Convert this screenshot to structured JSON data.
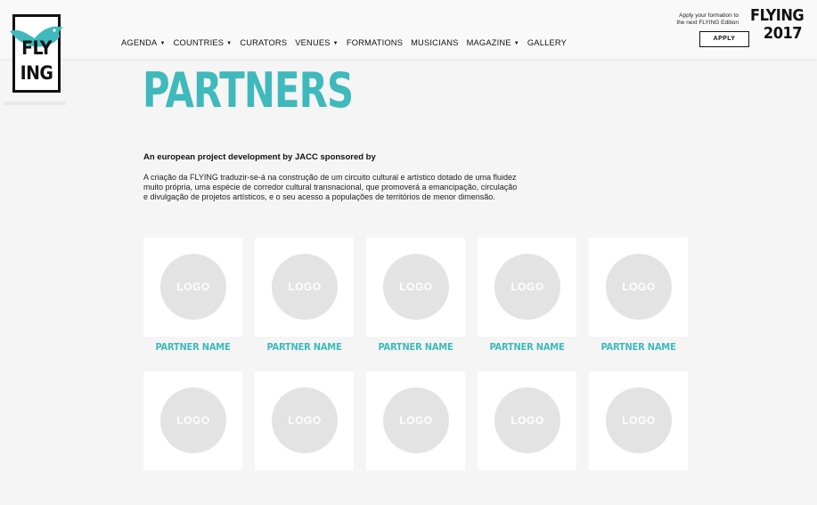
{
  "brand": {
    "logo_line1": "FLY",
    "logo_line2": "ING"
  },
  "nav": [
    {
      "label": "AGENDA",
      "caret": "▼"
    },
    {
      "label": "COUNTRIES",
      "caret": "▼"
    },
    {
      "label": "CURATORS",
      "caret": ""
    },
    {
      "label": "VENUES",
      "caret": "▼"
    },
    {
      "label": "FORMATIONS",
      "caret": ""
    },
    {
      "label": "MUSICIANS",
      "caret": ""
    },
    {
      "label": "MAGAZINE",
      "caret": "▼"
    },
    {
      "label": "GALLERY",
      "caret": ""
    }
  ],
  "apply": {
    "text_line1": "Apply your formation to",
    "text_line2": "the next FLYING Edition",
    "button": "APPLY"
  },
  "edition": {
    "line1": "FLYING",
    "line2": "2017"
  },
  "page": {
    "title": "PARTNERS",
    "subtitle": "An european project development by JACC sponsored by",
    "intro": "A criação da FLYING traduzir-se-á na construção de um circuito cultural e artístico dotado de uma fluidez muito própria, uma espécie de corredor cultural transnacional, que promoverá a emancipação, circulação e divulgação de projetos artísticos, e o seu acesso a populações de territórios de menor dimensão."
  },
  "partners": [
    {
      "logo": "LOGO",
      "name": "PARTNER NAME"
    },
    {
      "logo": "LOGO",
      "name": "PARTNER NAME"
    },
    {
      "logo": "LOGO",
      "name": "PARTNER NAME"
    },
    {
      "logo": "LOGO",
      "name": "PARTNER NAME"
    },
    {
      "logo": "LOGO",
      "name": "PARTNER NAME"
    },
    {
      "logo": "LOGO",
      "name": ""
    },
    {
      "logo": "LOGO",
      "name": ""
    },
    {
      "logo": "LOGO",
      "name": ""
    },
    {
      "logo": "LOGO",
      "name": ""
    },
    {
      "logo": "LOGO",
      "name": ""
    }
  ],
  "colors": {
    "accent": "#3fb9bb",
    "placeholder": "#e3e3e3",
    "background": "#f4f5f4"
  },
  "icons": {
    "logo_bird": "bird-icon",
    "dropdown": "chevron-down-icon"
  }
}
